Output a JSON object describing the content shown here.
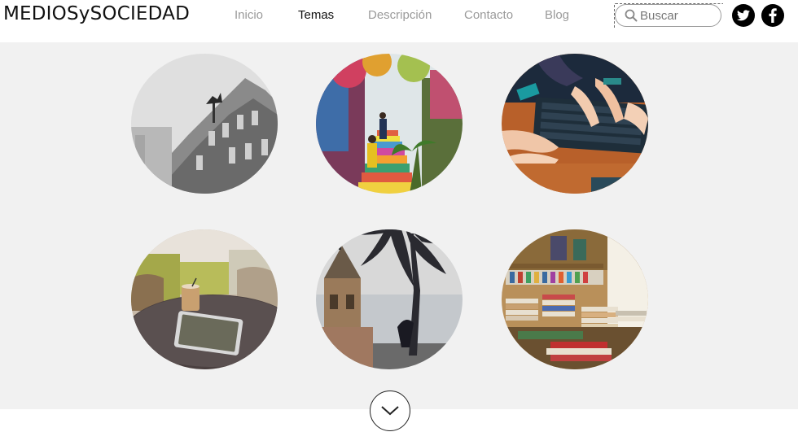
{
  "header": {
    "logo": "MEDIOSySOCIEDAD",
    "nav": [
      {
        "label": "Inicio",
        "active": false
      },
      {
        "label": "Temas",
        "active": true
      },
      {
        "label": "Descripción",
        "active": false
      },
      {
        "label": "Contacto",
        "active": false
      },
      {
        "label": "Blog",
        "active": false
      }
    ],
    "search": {
      "placeholder": "Buscar",
      "value": "",
      "icon": "search-icon"
    },
    "social": [
      {
        "name": "twitter",
        "icon": "twitter-icon"
      },
      {
        "name": "facebook",
        "icon": "facebook-icon"
      }
    ]
  },
  "gallery": {
    "items": [
      {
        "subject": "building-statue",
        "icon": "photo-building"
      },
      {
        "subject": "colorful-stairs",
        "icon": "photo-stairs"
      },
      {
        "subject": "keyboard-hands",
        "icon": "photo-keyboard"
      },
      {
        "subject": "cafe-tablet",
        "icon": "photo-cafe"
      },
      {
        "subject": "church-palm",
        "icon": "photo-church"
      },
      {
        "subject": "library-books",
        "icon": "photo-books"
      }
    ]
  },
  "scroll_button": {
    "icon": "chevron-down-icon"
  },
  "colors": {
    "background": "#f1f1f1",
    "nav_active": "#111111",
    "nav_inactive": "#9a9a9a"
  }
}
